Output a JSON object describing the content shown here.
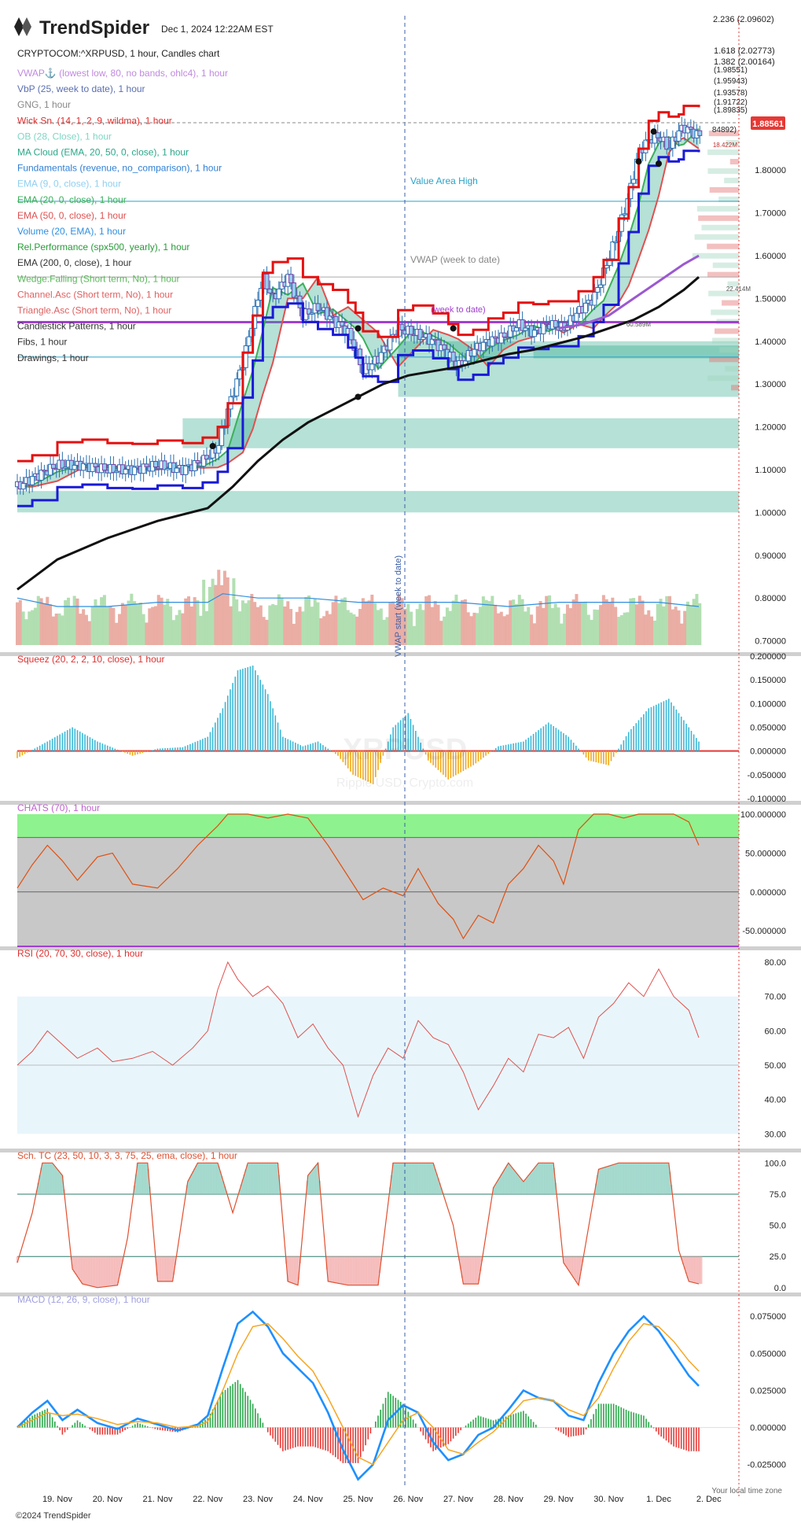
{
  "brand": {
    "name": "TrendSpider",
    "copyright": "©2024 TrendSpider",
    "watermark_symbol": "XRPUSD",
    "watermark_name": "Ripple USD, Crypto.com"
  },
  "header": {
    "datetime": "Dec 1, 2024 12:22AM EST",
    "instrument": "CRYPTOCOM:^XRPUSD, 1 hour, Candles chart"
  },
  "indicators": [
    {
      "label": "VWAP⚓ (lowest low, 80, no bands, ohlc4), 1 hour",
      "color": "#c08ae0"
    },
    {
      "label": "VbP (25, week to date), 1 hour",
      "color": "#5a6fb0"
    },
    {
      "label": "GNG, 1 hour",
      "color": "#888888"
    },
    {
      "label": "Wick Sn. (14, 1, 2, 9, wildma), 1 hour",
      "color": "#e03030"
    },
    {
      "label": "OB (28, Close), 1 hour",
      "color": "#7fd6c6"
    },
    {
      "label": "MA Cloud (EMA, 20, 50, 0, close), 1 hour",
      "color": "#2aa88a"
    },
    {
      "label": "Fundamentals (revenue, no_comparison), 1 hour",
      "color": "#2f7fd6"
    },
    {
      "label": "EMA (9, 0, close), 1 hour",
      "color": "#8fd0f0"
    },
    {
      "label": "EMA (20, 0, close), 1 hour",
      "color": "#3bb05a"
    },
    {
      "label": "EMA (50, 0, close), 1 hour",
      "color": "#e05050"
    },
    {
      "label": "Volume (20, EMA), 1 hour",
      "color": "#2f8fe0"
    },
    {
      "label": "Rel.Performance (spx500, yearly), 1 hour",
      "color": "#2a9a3a"
    },
    {
      "label": "EMA (200, 0, close), 1 hour",
      "color": "#333333"
    },
    {
      "label": "Wedge.Falling (Short term, No), 1 hour",
      "color": "#5cb85c"
    },
    {
      "label": "Channel.Asc (Short term, No), 1 hour",
      "color": "#e06060"
    },
    {
      "label": "Triangle.Asc (Short term, No), 1 hour",
      "color": "#e06060"
    },
    {
      "label": "Candlestick Patterns, 1 hour",
      "color": "#333333"
    },
    {
      "label": "Fibs, 1 hour",
      "color": "#333333"
    },
    {
      "label": "Drawings, 1 hour",
      "color": "#333333"
    }
  ],
  "annotations": {
    "value_area_high": "Value Area High",
    "vwap_week": "VWAP (week to date)",
    "vwap_start": "VWAP start (week to date)",
    "vwap_week_short": "(week to date)",
    "local_time": "Your local time zone"
  },
  "fib_labels": [
    "2.236 (2.09602)",
    "1.618 (2.02773)",
    "1.382 (2.00164)",
    "(1.98551)",
    "(1.95943)",
    "(1.93578)",
    "(1.91722)",
    "(1.89835)",
    "84892)"
  ],
  "price_badge": {
    "value": "1.88561",
    "color": "#e53935"
  },
  "volume_profile_labels": [
    "18.422M",
    "22.414M",
    "60.589M"
  ],
  "chart_data": [
    {
      "type": "candlestick",
      "title": "CRYPTOCOM:^XRPUSD, 1 hour, Candles chart",
      "y_ticks": [
        "1.80000",
        "1.70000",
        "1.60000",
        "1.50000",
        "1.40000",
        "1.30000",
        "1.20000",
        "1.10000",
        "1.00000",
        "0.90000",
        "0.80000",
        "0.70000"
      ],
      "y_tick_values": [
        1.8,
        1.7,
        1.6,
        1.5,
        1.4,
        1.3,
        1.2,
        1.1,
        1.0,
        0.9,
        0.8,
        0.7
      ],
      "ylim": [
        0.69,
        1.94
      ],
      "x_ticks": [
        "19. Nov",
        "20. Nov",
        "21. Nov",
        "22. Nov",
        "23. Nov",
        "24. Nov",
        "25. Nov",
        "26. Nov",
        "27. Nov",
        "28. Nov",
        "29. Nov",
        "30. Nov",
        "1. Dec",
        "2. Dec"
      ],
      "x_tick_days": [
        0,
        1,
        2,
        3,
        4,
        5,
        6,
        7,
        8,
        9,
        10,
        11,
        12,
        13
      ],
      "xlim": [
        -0.8,
        13.6
      ],
      "close": {
        "days": [
          -0.8,
          -0.5,
          0,
          0.5,
          1,
          1.5,
          2,
          2.5,
          2.9,
          3.2,
          3.4,
          3.7,
          3.9,
          4.1,
          4.3,
          4.6,
          4.9,
          5.2,
          5.5,
          5.8,
          5.95,
          6.1,
          6.4,
          6.8,
          7.1,
          7.5,
          7.8,
          8.0,
          8.3,
          8.6,
          8.9,
          9.2,
          9.5,
          9.8,
          10.1,
          10.4,
          10.7,
          10.9,
          11.2,
          11.4,
          11.6,
          11.8,
          12.0,
          12.2,
          12.4,
          12.5,
          12.8
        ],
        "values": [
          1.06,
          1.08,
          1.11,
          1.11,
          1.1,
          1.1,
          1.11,
          1.1,
          1.12,
          1.15,
          1.24,
          1.35,
          1.45,
          1.55,
          1.5,
          1.55,
          1.46,
          1.48,
          1.45,
          1.42,
          1.38,
          1.33,
          1.36,
          1.43,
          1.42,
          1.4,
          1.37,
          1.34,
          1.38,
          1.4,
          1.41,
          1.44,
          1.42,
          1.44,
          1.43,
          1.47,
          1.5,
          1.56,
          1.66,
          1.74,
          1.84,
          1.87,
          1.88,
          1.85,
          1.89,
          1.9,
          1.88
        ]
      },
      "ema200": {
        "days": [
          -0.8,
          0,
          1,
          2,
          3,
          3.5,
          4,
          4.5,
          5,
          5.5,
          6,
          6.5,
          7,
          7.5,
          8,
          8.5,
          9,
          9.5,
          10,
          10.5,
          11,
          11.5,
          12,
          12.5,
          12.8
        ],
        "values": [
          0.82,
          0.89,
          0.94,
          0.98,
          1.01,
          1.06,
          1.12,
          1.17,
          1.21,
          1.24,
          1.27,
          1.3,
          1.32,
          1.33,
          1.34,
          1.355,
          1.37,
          1.38,
          1.395,
          1.41,
          1.43,
          1.45,
          1.48,
          1.52,
          1.55
        ]
      },
      "volume_ema_days": [
        -0.8,
        0,
        1,
        2,
        3,
        3.3,
        4,
        5,
        6,
        7,
        8,
        9,
        10,
        11,
        12,
        12.8
      ],
      "volume_ema_values": [
        0.8,
        0.78,
        0.78,
        0.79,
        0.79,
        0.81,
        0.8,
        0.8,
        0.79,
        0.79,
        0.79,
        0.78,
        0.79,
        0.79,
        0.79,
        0.78
      ],
      "levels": [
        {
          "name": "Value Area High",
          "value": 1.727
        },
        {
          "name": "VWAP (week to date)",
          "value": 1.55
        }
      ]
    },
    {
      "type": "bar",
      "title": "Squeez (20, 2, 2, 10, close), 1 hour",
      "y_ticks": [
        "0.200000",
        "0.150000",
        "0.100000",
        "0.050000",
        "0.000000",
        "-0.050000",
        "-0.100000"
      ],
      "y_tick_values": [
        0.2,
        0.15,
        0.1,
        0.05,
        0.0,
        -0.05,
        -0.1
      ],
      "ylim": [
        -0.105,
        0.2
      ],
      "days": [
        -0.8,
        -0.2,
        0.3,
        0.8,
        1.5,
        2,
        2.5,
        3,
        3.3,
        3.6,
        3.9,
        4.2,
        4.5,
        4.9,
        5.2,
        5.6,
        5.9,
        6.3,
        6.7,
        7.0,
        7.4,
        7.8,
        8.3,
        8.8,
        9.3,
        9.8,
        10.2,
        10.6,
        11.0,
        11.4,
        11.8,
        12.2,
        12.8
      ],
      "values": [
        -0.015,
        0.02,
        0.05,
        0.02,
        -0.01,
        0.005,
        0.008,
        0.03,
        0.09,
        0.17,
        0.18,
        0.12,
        0.03,
        0.01,
        0.02,
        -0.01,
        -0.05,
        -0.07,
        0.05,
        0.08,
        -0.02,
        -0.06,
        -0.03,
        0.01,
        0.02,
        0.06,
        0.03,
        -0.02,
        -0.03,
        0.04,
        0.09,
        0.11,
        0.02
      ]
    },
    {
      "type": "line",
      "title": "CHATS (70), 1 hour",
      "y_ticks": [
        "100.000000",
        "50.000000",
        "0.000000",
        "-50.000000"
      ],
      "y_tick_values": [
        100,
        50,
        0,
        -50
      ],
      "ylim": [
        -70,
        105
      ],
      "zones": {
        "upper": [
          70,
          100
        ],
        "lower": [
          -100,
          -70
        ]
      },
      "days": [
        -0.8,
        -0.5,
        -0.2,
        0.1,
        0.4,
        0.8,
        1.1,
        1.5,
        2.0,
        2.4,
        2.8,
        3.2,
        3.4,
        3.8,
        4.2,
        4.6,
        5.0,
        5.4,
        5.8,
        6.1,
        6.5,
        6.9,
        7.2,
        7.6,
        7.9,
        8.1,
        8.4,
        8.7,
        9.0,
        9.3,
        9.6,
        9.9,
        10.1,
        10.4,
        10.7,
        11.0,
        11.3,
        11.6,
        12.0,
        12.3,
        12.6,
        12.8
      ],
      "values": [
        5,
        35,
        60,
        40,
        15,
        45,
        50,
        10,
        5,
        30,
        60,
        85,
        100,
        100,
        95,
        100,
        95,
        60,
        20,
        -10,
        5,
        -5,
        30,
        -15,
        -35,
        -60,
        -30,
        -40,
        10,
        30,
        60,
        40,
        10,
        80,
        100,
        100,
        95,
        100,
        100,
        100,
        90,
        60
      ]
    },
    {
      "type": "line",
      "title": "RSI (20, 70, 30, close), 1 hour",
      "y_ticks": [
        "80.00",
        "70.00",
        "60.00",
        "50.00",
        "40.00",
        "30.00"
      ],
      "y_tick_values": [
        80,
        70,
        60,
        50,
        40,
        30
      ],
      "ylim": [
        28,
        83
      ],
      "zone": [
        30,
        70
      ],
      "days": [
        -0.8,
        -0.5,
        -0.2,
        0.1,
        0.4,
        0.8,
        1.1,
        1.5,
        1.9,
        2.3,
        2.7,
        3.0,
        3.2,
        3.4,
        3.6,
        3.9,
        4.2,
        4.5,
        4.8,
        5.1,
        5.4,
        5.7,
        6.0,
        6.3,
        6.6,
        6.9,
        7.2,
        7.5,
        7.8,
        8.1,
        8.4,
        8.7,
        9.0,
        9.3,
        9.6,
        9.9,
        10.2,
        10.5,
        10.8,
        11.1,
        11.4,
        11.7,
        12.0,
        12.3,
        12.6,
        12.8
      ],
      "values": [
        50,
        54,
        60,
        56,
        52,
        55,
        51,
        52,
        54,
        50,
        55,
        60,
        72,
        80,
        75,
        70,
        73,
        68,
        58,
        62,
        55,
        50,
        35,
        47,
        55,
        52,
        63,
        58,
        56,
        48,
        37,
        44,
        52,
        48,
        59,
        58,
        61,
        52,
        64,
        68,
        74,
        70,
        78,
        70,
        66,
        58
      ]
    },
    {
      "type": "area",
      "title": "Sch. TC (23, 50, 10, 3, 3, 75, 25, ema, close), 1 hour",
      "y_ticks": [
        "100.0",
        "75.0",
        "50.0",
        "25.0",
        "0.0"
      ],
      "y_tick_values": [
        100,
        75,
        50,
        25,
        0
      ],
      "ylim": [
        -2,
        104
      ],
      "bands": [
        25,
        75
      ],
      "days": [
        -0.8,
        -0.5,
        -0.3,
        -0.1,
        0.1,
        0.3,
        0.5,
        0.8,
        1.2,
        1.4,
        1.6,
        1.8,
        2.0,
        2.3,
        2.6,
        2.8,
        3.0,
        3.2,
        3.5,
        3.8,
        4.2,
        4.4,
        4.6,
        4.8,
        5.0,
        5.2,
        5.4,
        5.8,
        6.1,
        6.4,
        6.7,
        6.9,
        7.2,
        7.5,
        7.9,
        8.1,
        8.4,
        8.7,
        9.0,
        9.3,
        9.6,
        9.9,
        10.1,
        10.4,
        10.8,
        11.2,
        11.6,
        12.0,
        12.2,
        12.4,
        12.6,
        12.8
      ],
      "values": [
        20,
        60,
        100,
        100,
        90,
        15,
        3,
        0,
        2,
        40,
        100,
        100,
        5,
        5,
        85,
        100,
        100,
        100,
        60,
        100,
        100,
        100,
        5,
        2,
        90,
        100,
        5,
        2,
        2,
        2,
        100,
        100,
        100,
        100,
        50,
        3,
        3,
        80,
        100,
        85,
        100,
        100,
        20,
        2,
        95,
        100,
        100,
        100,
        100,
        30,
        5,
        3
      ]
    },
    {
      "type": "line",
      "title": "MACD (12, 26, 9, close), 1 hour",
      "y_ticks": [
        "0.075000",
        "0.050000",
        "0.025000",
        "0.000000",
        "-0.025000"
      ],
      "y_tick_values": [
        0.075,
        0.05,
        0.025,
        0.0,
        -0.025
      ],
      "ylim": [
        -0.04,
        0.082
      ],
      "days": [
        -0.8,
        -0.5,
        -0.2,
        0.1,
        0.4,
        0.8,
        1.2,
        1.6,
        2.0,
        2.4,
        2.8,
        3.0,
        3.3,
        3.6,
        3.9,
        4.2,
        4.5,
        4.8,
        5.1,
        5.4,
        5.7,
        6.0,
        6.3,
        6.6,
        6.9,
        7.2,
        7.5,
        7.8,
        8.1,
        8.4,
        8.7,
        9.0,
        9.3,
        9.6,
        9.9,
        10.2,
        10.5,
        10.8,
        11.1,
        11.4,
        11.7,
        12.0,
        12.3,
        12.6,
        12.8
      ],
      "series": [
        {
          "name": "MACD",
          "color": "#1e90ff",
          "values": [
            0.0,
            0.01,
            0.018,
            0.005,
            0.012,
            0.003,
            -0.001,
            0.006,
            0.002,
            -0.002,
            0.002,
            0.008,
            0.04,
            0.07,
            0.078,
            0.068,
            0.05,
            0.04,
            0.03,
            0.01,
            -0.015,
            -0.035,
            -0.025,
            0.005,
            0.015,
            0.01,
            -0.01,
            -0.022,
            -0.018,
            -0.005,
            0.0,
            0.012,
            0.025,
            0.02,
            0.018,
            0.008,
            0.005,
            0.03,
            0.05,
            0.065,
            0.075,
            0.065,
            0.05,
            0.035,
            0.028
          ]
        },
        {
          "name": "Signal",
          "color": "#f5a623",
          "values": [
            0.0,
            0.005,
            0.01,
            0.008,
            0.009,
            0.006,
            0.002,
            0.004,
            0.003,
            0.0,
            0.001,
            0.004,
            0.025,
            0.05,
            0.068,
            0.07,
            0.06,
            0.048,
            0.038,
            0.02,
            0.0,
            -0.02,
            -0.025,
            -0.01,
            0.005,
            0.01,
            0.0,
            -0.015,
            -0.018,
            -0.01,
            -0.003,
            0.007,
            0.018,
            0.02,
            0.018,
            0.012,
            0.008,
            0.02,
            0.04,
            0.058,
            0.07,
            0.068,
            0.058,
            0.045,
            0.038
          ]
        }
      ]
    }
  ]
}
